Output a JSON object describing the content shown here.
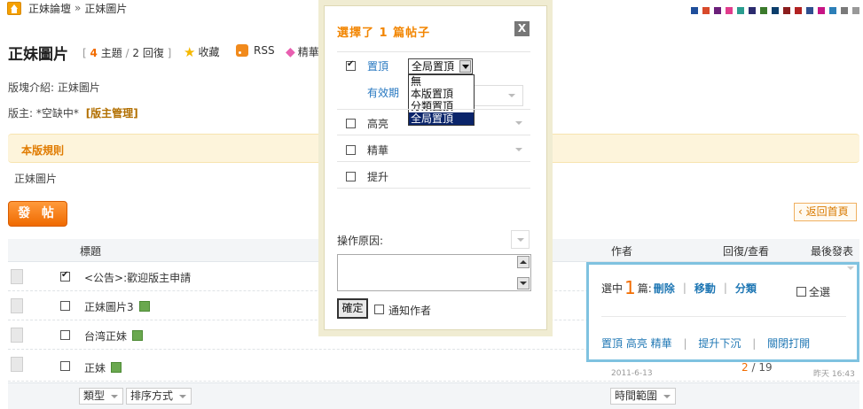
{
  "breadcrumb": {
    "root": "正妹論壇",
    "separator": "»",
    "current": "正妹圖片"
  },
  "color_swatches": [
    "#1f4e9b",
    "#d84a2b",
    "#6b1f7a",
    "#e13c8c",
    "#2a9d8f",
    "#2b2b6e",
    "#3b7a2c",
    "#0b3d6b",
    "#8b1d1d",
    "#b22222",
    "#2f4f8f",
    "#c71585",
    "#2c7fb8",
    "#7a7a7a",
    "#999999"
  ],
  "header": {
    "title": "正妹圖片",
    "topics_count": "4",
    "topics_label": "主題",
    "replies": "2 回復",
    "favorite": "收藏",
    "rss": "RSS",
    "digest": "精華"
  },
  "intro": "版塊介紹: 正妹圖片",
  "moderator": {
    "label": "版主: *空缺中*",
    "admin_link": "版主管理"
  },
  "rules": {
    "title": "本版規則",
    "text": "正妹圖片"
  },
  "post_button": "發 帖",
  "back_button": "返回首頁",
  "table": {
    "columns": {
      "title": "標題",
      "author": "作者",
      "replies_views": "回復/查看",
      "last_post": "最後發表"
    },
    "rows": [
      {
        "checked": true,
        "title": "<公告>:歡迎版主申請",
        "has_image": false
      },
      {
        "checked": false,
        "title": "正妹圖片3",
        "has_image": true
      },
      {
        "checked": false,
        "title": "台湾正妹",
        "has_image": true
      },
      {
        "checked": false,
        "title": "正妹",
        "has_image": true,
        "author_date": "2011-6-13",
        "replies": "2",
        "views": "/ 19",
        "last_date": "昨天 16:43"
      }
    ]
  },
  "filters": {
    "type": "類型",
    "sort": "排序方式",
    "time_range": "時間範圍"
  },
  "modal": {
    "title": "選擇了 1 篇帖子",
    "close": "X",
    "sticky": {
      "label": "置頂",
      "checked": true,
      "selected": "全局置頂",
      "options": [
        "無",
        "本版置頂",
        "分類置頂",
        "全局置頂"
      ]
    },
    "validity": "有效期",
    "highlight": "高亮",
    "digest": "精華",
    "bump": "提升",
    "reason_label": "操作原因:",
    "confirm": "確定",
    "notify_author": "通知作者"
  },
  "selection_panel": {
    "prefix": "選中",
    "count": "1",
    "unit": "篇:",
    "delete": "刪除",
    "move": "移動",
    "categorize": "分類",
    "select_all": "全選",
    "line2": "置頂 高亮 精華",
    "bump_sink": "提升下沉",
    "open_close": "關閉打開"
  }
}
